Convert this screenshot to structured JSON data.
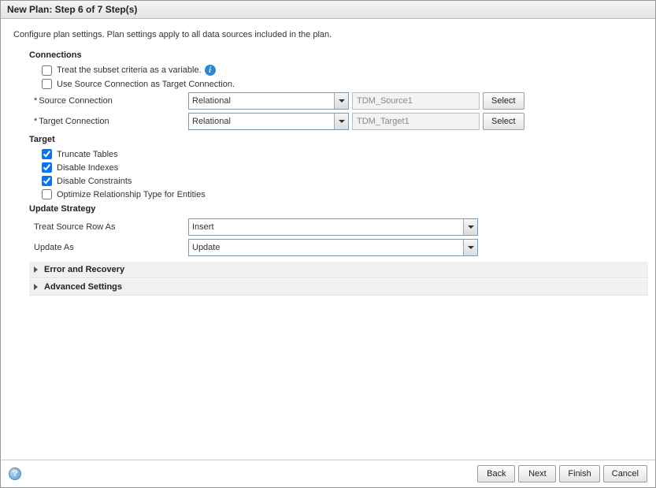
{
  "title": "New Plan: Step 6 of 7 Step(s)",
  "instruction": "Configure plan settings. Plan settings apply to all data sources included in the plan.",
  "connections": {
    "heading": "Connections",
    "treat_subset_label": "Treat the subset criteria as a variable.",
    "treat_subset_checked": false,
    "use_source_as_target_label": "Use Source Connection as Target Connection.",
    "use_source_as_target_checked": false,
    "source_label": "Source Connection",
    "source_type": "Relational",
    "source_name": "TDM_Source1",
    "target_label": "Target Connection",
    "target_type": "Relational",
    "target_name": "TDM_Target1",
    "select_btn": "Select"
  },
  "target": {
    "heading": "Target",
    "truncate_label": "Truncate Tables",
    "truncate_checked": true,
    "disable_indexes_label": "Disable Indexes",
    "disable_indexes_checked": true,
    "disable_constraints_label": "Disable Constraints",
    "disable_constraints_checked": true,
    "optimize_label": "Optimize Relationship Type for Entities",
    "optimize_checked": false
  },
  "update_strategy": {
    "heading": "Update Strategy",
    "treat_row_label": "Treat Source Row As",
    "treat_row_value": "Insert",
    "update_as_label": "Update As",
    "update_as_value": "Update"
  },
  "sections": {
    "error_recovery": "Error and Recovery",
    "advanced": "Advanced Settings"
  },
  "footer": {
    "help": "?",
    "back": "Back",
    "next": "Next",
    "finish": "Finish",
    "cancel": "Cancel"
  }
}
